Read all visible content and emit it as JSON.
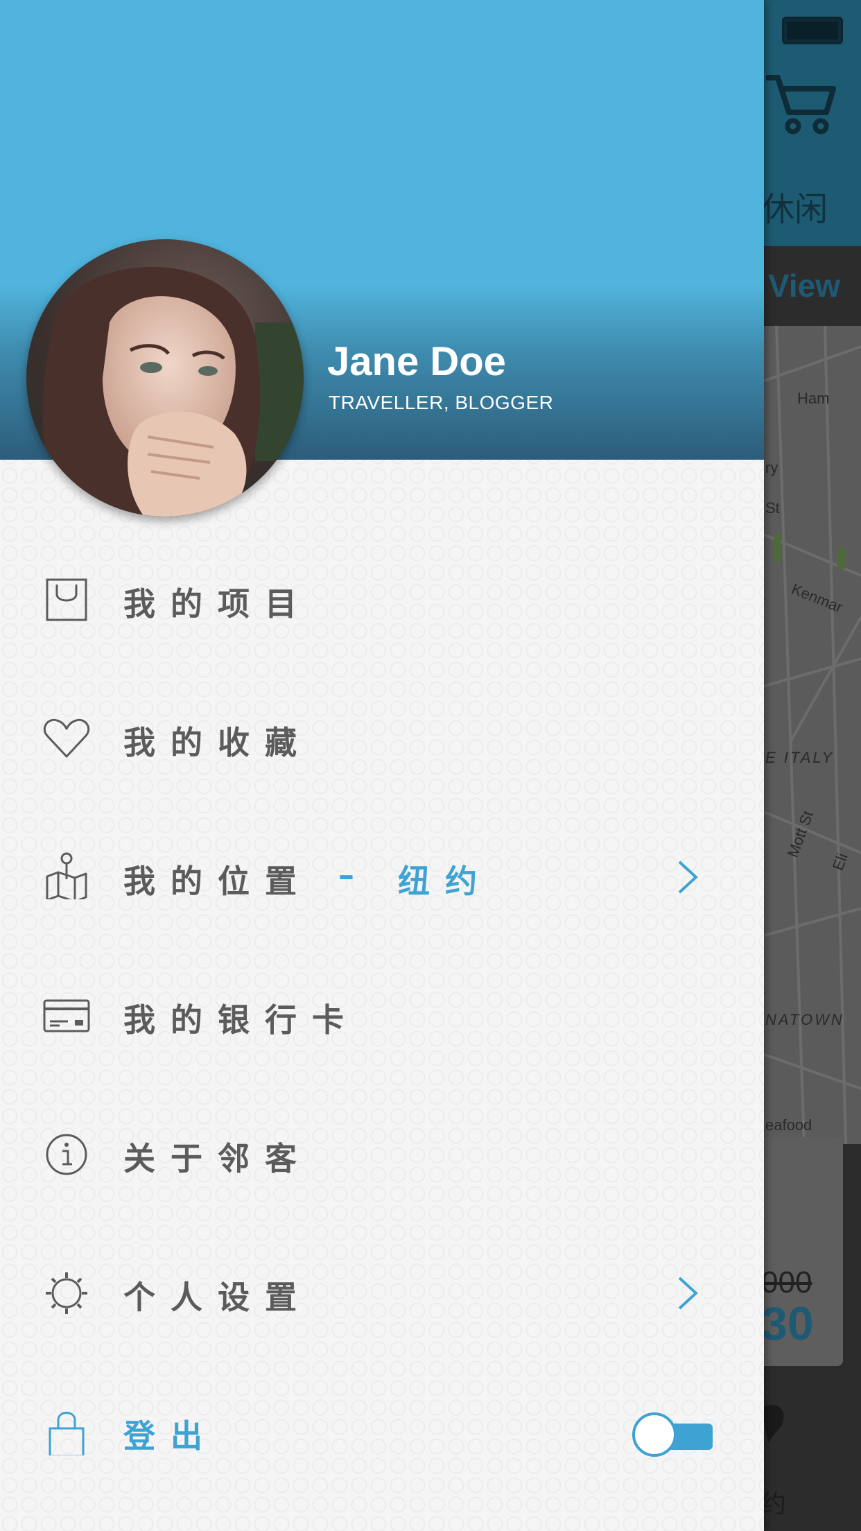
{
  "background_app": {
    "category_text": "休闲",
    "map_view_text": "View",
    "map_labels": [
      "Ham",
      "ry",
      "St",
      "Kenmar",
      "E ITALY",
      "Mott St",
      "Eli",
      "NATOWN",
      "eafood"
    ],
    "price_old": "000",
    "price_new": "30",
    "bottom_label": "约"
  },
  "profile": {
    "name": "Jane Doe",
    "title": "TRAVELLER, BLOGGER"
  },
  "menu": {
    "projects": {
      "label": "我的项目",
      "icon": "shopping-bag-icon"
    },
    "favorites": {
      "label": "我的收藏",
      "icon": "heart-icon"
    },
    "location": {
      "label": "我的位置",
      "separator": "–",
      "value": "纽约",
      "icon": "map-pin-icon"
    },
    "bank_card": {
      "label": "我的银行卡",
      "icon": "credit-card-icon"
    },
    "about": {
      "label": "关于邻客",
      "icon": "info-icon"
    },
    "settings": {
      "label": "个人设置",
      "icon": "gear-icon"
    },
    "logout": {
      "label": "登出",
      "icon": "lock-icon",
      "toggle_on": true
    }
  },
  "colors": {
    "header_blue": "#50b4dd",
    "accent": "#3ea3d2",
    "menu_text": "#5b5b5b",
    "drawer_bg": "#f5f5f5"
  }
}
